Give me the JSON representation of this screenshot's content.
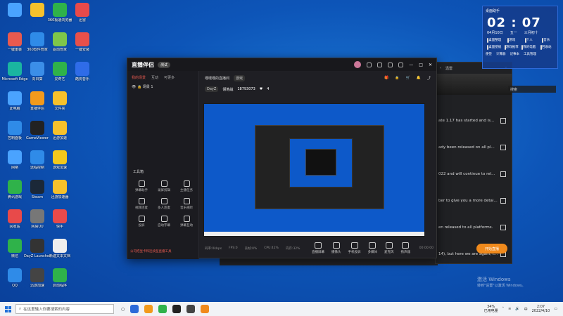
{
  "desktop": {
    "icons": [
      {
        "label": "",
        "color": "#4aa3ff",
        "col": 0,
        "row": 0
      },
      {
        "label": "",
        "color": "#f6c12b",
        "col": 1,
        "row": 0
      },
      {
        "label": "360极速浏览器",
        "color": "#2fb24a",
        "col": 2,
        "row": 0
      },
      {
        "label": "迅雷",
        "color": "#e84a4a",
        "col": 3,
        "row": 0
      },
      {
        "label": "一键重装",
        "color": "#e85a4f",
        "col": 0,
        "row": 1
      },
      {
        "label": "360软件管家",
        "color": "#2f8be8",
        "col": 1,
        "row": 1
      },
      {
        "label": "驱动管家",
        "color": "#7ec64a",
        "col": 2,
        "row": 1
      },
      {
        "label": "一键安装",
        "color": "#e8504a",
        "col": 3,
        "row": 1
      },
      {
        "label": "Microsoft Edge",
        "color": "#1ab5a0",
        "col": 0,
        "row": 2
      },
      {
        "label": "向日葵",
        "color": "#3b8ee8",
        "col": 1,
        "row": 2
      },
      {
        "label": "爱奇艺",
        "color": "#2fb24a",
        "col": 2,
        "row": 2
      },
      {
        "label": "酷狗音乐",
        "color": "#2f6ce8",
        "col": 3,
        "row": 2
      },
      {
        "label": "此电脑",
        "color": "#4aa3ff",
        "col": 0,
        "row": 3
      },
      {
        "label": "直播伴侣",
        "color": "#f29a1c",
        "col": 1,
        "row": 3
      },
      {
        "label": "文件夹",
        "color": "#f6c12b",
        "col": 2,
        "row": 3
      },
      {
        "label": "控制面板",
        "color": "#2f8be8",
        "col": 0,
        "row": 4
      },
      {
        "label": "GameViewer",
        "color": "#222",
        "col": 1,
        "row": 4
      },
      {
        "label": "迅游加速",
        "color": "#f6c12b",
        "col": 2,
        "row": 4
      },
      {
        "label": "网络",
        "color": "#4aa3ff",
        "col": 0,
        "row": 5
      },
      {
        "label": "远程控制",
        "color": "#2f8be8",
        "col": 1,
        "row": 5
      },
      {
        "label": "游戏加速",
        "color": "#f2c81c",
        "col": 2,
        "row": 5
      },
      {
        "label": "腾讯游戏",
        "color": "#2fb24a",
        "col": 0,
        "row": 6
      },
      {
        "label": "Steam",
        "color": "#1b2838",
        "col": 1,
        "row": 6
      },
      {
        "label": "迅游加速器",
        "color": "#f6c12b",
        "col": 2,
        "row": 6
      },
      {
        "label": "回收站",
        "color": "#e84a4a",
        "col": 0,
        "row": 7
      },
      {
        "label": "网易UU",
        "color": "#777",
        "col": 1,
        "row": 7
      },
      {
        "label": "快手",
        "color": "#e84a4a",
        "col": 2,
        "row": 7
      },
      {
        "label": "微信",
        "color": "#2fb24a",
        "col": 0,
        "row": 8
      },
      {
        "label": "DayZ Launcher",
        "color": "#333",
        "col": 1,
        "row": 8
      },
      {
        "label": "新建文本文档",
        "color": "#eee",
        "col": 2,
        "row": 8
      },
      {
        "label": "QQ",
        "color": "#2f8be8",
        "col": 0,
        "row": 9
      },
      {
        "label": "迅游加速",
        "color": "#444",
        "col": 1,
        "row": 9
      },
      {
        "label": "启动程序",
        "color": "#2fb24a",
        "col": 2,
        "row": 9
      }
    ]
  },
  "app": {
    "logo": "直播伴侣",
    "version": "测试",
    "sidebar_tabs": [
      "我的场景",
      "互动",
      "可更多"
    ],
    "scene_name": "场景 1",
    "tools_title": "工具箱",
    "tools": [
      "弹幕助手",
      "录屏剪辑",
      "主播任务",
      "视频连麦",
      "多人连麦",
      "音乐视听",
      "投屏",
      "自动字幕",
      "弹幕互动"
    ],
    "tip": "公司把显卡和连续型直播工具",
    "room_title": "嘿嘿嘿的直播间",
    "room_tag": "游戏",
    "game": "DayZ",
    "category": "领地战",
    "room_id": "18793073",
    "likes": "4",
    "controls": [
      "直播屏幕",
      "摄像头",
      "手机投屏",
      "多媒体",
      "麦克风",
      "扬声器"
    ],
    "go_live": "开始直播",
    "status": [
      "码率:0kbps",
      "FPS:0",
      "丢帧:0%",
      "CPU:42%",
      "内存:32%"
    ],
    "timer": "00:00:00"
  },
  "browser": {
    "tab": "迅雷",
    "news": [
      "ate 1.17 has started and is...",
      "ady been released on all pl...",
      "022 and will continue to rel...",
      "ber to give you a more detai...",
      "en released to all platforms.",
      "14), but here we are again, t..."
    ]
  },
  "clock": {
    "title": "桌面助手",
    "time": "02 : 07",
    "date": "04月10日",
    "weekday": "五一",
    "lunar": "三月初十",
    "shortcuts": [
      "桌面整理",
      "游戏",
      "个人",
      "音乐",
      "桌面壁纸",
      "游戏推荐",
      "我的电脑",
      "回收站"
    ],
    "tools": [
      "便签",
      "计算器",
      "记事本",
      "工具管理"
    ],
    "search": "搜索"
  },
  "watermark": {
    "title": "激活 Windows",
    "subtitle": "转到\"设置\"以激活 Windows。"
  },
  "taskbar": {
    "search_placeholder": "在这里输入你要搜索的内容",
    "tray_battery": "34%",
    "tray_battery_sub": "已用电量",
    "time": "2:07",
    "date": "2022/4/10"
  }
}
